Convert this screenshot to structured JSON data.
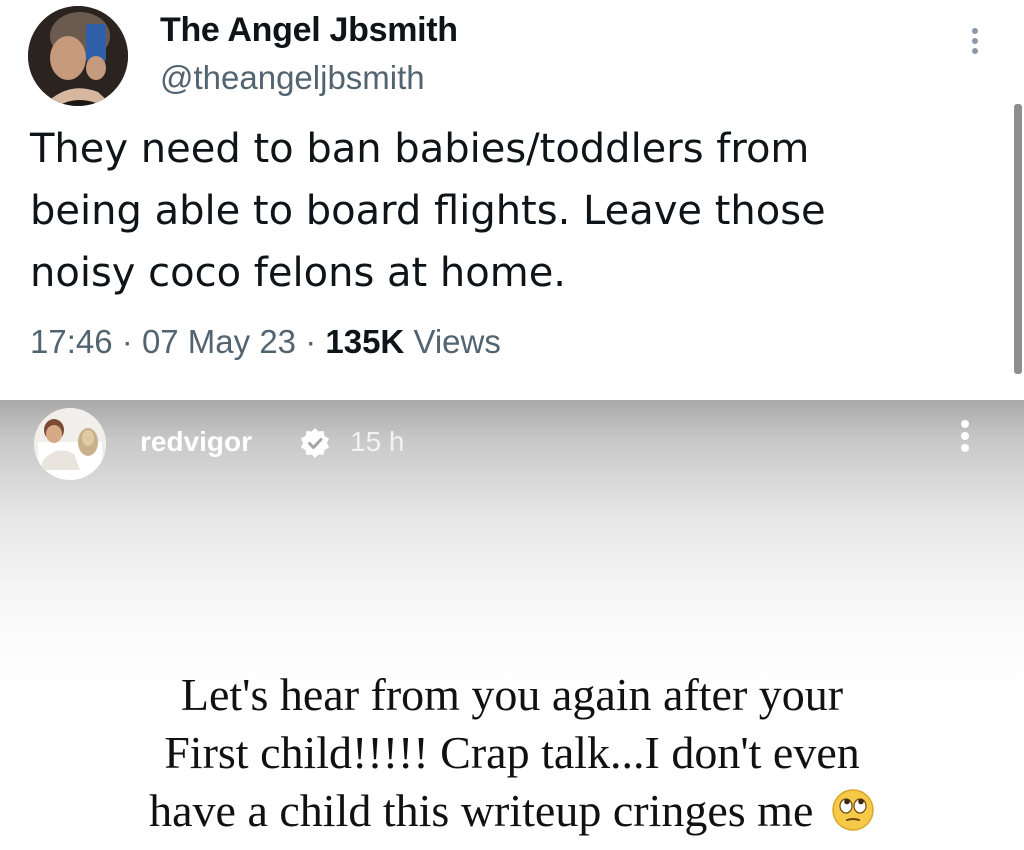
{
  "tweet": {
    "author_name": "The Angel Jbsmith",
    "author_handle": "@theangeljbsmith",
    "text_lines": [
      "They need to ban babies/toddlers from",
      "being able to board flights. Leave those",
      "noisy coco felons at home."
    ],
    "time": "17:46",
    "separator": "·",
    "date": "07 May 23",
    "views_count": "135K",
    "views_label": "Views",
    "more_icon": "more-vertical-icon"
  },
  "story": {
    "username": "redvigor",
    "verified_icon": "verified-badge-icon",
    "age": "15 h",
    "more_icon": "more-vertical-icon",
    "caption_lines": [
      "Let's hear from you again after your",
      "First child!!!!! Crap talk...I don't even",
      "have a child this writeup cringes me"
    ],
    "caption_emoji": "face-with-rolling-eyes-emoji"
  },
  "colors": {
    "tweet_text": "#0f1419",
    "tweet_secondary": "#536471",
    "story_header_text": "#ffffff",
    "story_caption": "#111111"
  }
}
